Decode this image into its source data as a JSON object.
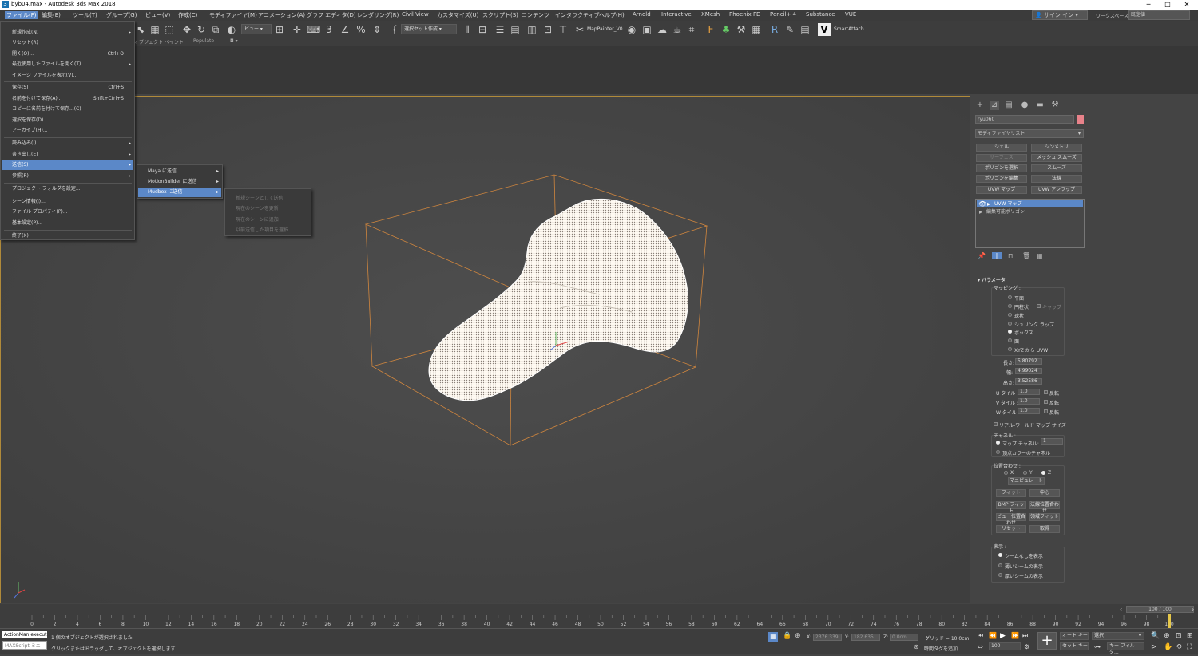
{
  "window": {
    "title": "byb04.max - Autodesk 3ds Max 2018",
    "minimize": "─",
    "maximize": "□",
    "close": "✕"
  },
  "menubar": {
    "items": [
      "ファイル(F)",
      "編集(E)",
      "ツール(T)",
      "グループ(G)",
      "ビュー(V)",
      "作成(C)",
      "モディファイヤ(M)",
      "アニメーション(A)",
      "グラフ エディタ(D)",
      "レンダリング(R)",
      "Civil View",
      "カスタマイズ(U)",
      "スクリプト(S)",
      "コンテンツ",
      "インタラクティブ",
      "ヘルプ(H)",
      "Arnold",
      "Interactive",
      "XMesh",
      "Phoenix FD",
      "Pencil+ 4",
      "Substance",
      "VUE"
    ],
    "signin": "サイン イン",
    "workspace_label": "ワークスペース:",
    "workspace_value": "既定値"
  },
  "toolbar": {
    "view_dropdown": "ビュー",
    "selection_set": "選択セット作成",
    "mappainter": "MapPainter_V0",
    "smartattach": "SmartAttach",
    "ribbon_label1": "オブジェクト ペイント",
    "ribbon_label2": "Populate"
  },
  "file_menu": {
    "items": [
      {
        "label": "新規作成(N)",
        "shortcut": "",
        "arrow": "▸"
      },
      {
        "label": "リセット(R)",
        "shortcut": "",
        "arrow": ""
      },
      {
        "label": "開く(O)...",
        "shortcut": "Ctrl+O",
        "arrow": ""
      },
      {
        "label": "最近使用したファイルを開く(T)",
        "shortcut": "",
        "arrow": "▸"
      },
      {
        "label": "イメージ ファイルを表示(V)...",
        "shortcut": "",
        "arrow": ""
      },
      {
        "label": "保存(S)",
        "shortcut": "Ctrl+S",
        "arrow": ""
      },
      {
        "label": "名前を付けて保存(A)...",
        "shortcut": "Shift+Ctrl+S",
        "arrow": ""
      },
      {
        "label": "コピーに名前を付けて保存...(C)",
        "shortcut": "",
        "arrow": ""
      },
      {
        "label": "選択を保存(D)...",
        "shortcut": "",
        "arrow": ""
      },
      {
        "label": "アーカイブ(H)...",
        "shortcut": "",
        "arrow": ""
      },
      {
        "label": "読み込み(I)",
        "shortcut": "",
        "arrow": "▸"
      },
      {
        "label": "書き出し(E)",
        "shortcut": "",
        "arrow": "▸"
      },
      {
        "label": "送信(S)",
        "shortcut": "",
        "arrow": "▸"
      },
      {
        "label": "参照(R)",
        "shortcut": "",
        "arrow": "▸"
      },
      {
        "label": "プロジェクト フォルダを設定...",
        "shortcut": "",
        "arrow": ""
      },
      {
        "label": "シーン情報(I)...",
        "shortcut": "",
        "arrow": ""
      },
      {
        "label": "ファイル プロパティ(P)...",
        "shortcut": "",
        "arrow": ""
      },
      {
        "label": "基本設定(P)...",
        "shortcut": "",
        "arrow": ""
      },
      {
        "label": "終了(X)",
        "shortcut": "",
        "arrow": ""
      }
    ]
  },
  "send_submenu": {
    "items": [
      {
        "label": "Maya に送信",
        "arrow": "▸"
      },
      {
        "label": "MotionBuilder に送信",
        "arrow": "▸"
      },
      {
        "label": "Mudbox に送信",
        "arrow": "▸"
      }
    ]
  },
  "mudbox_submenu": {
    "items": [
      "新規シーンとして送信",
      "現在のシーンを更新",
      "現在のシーンに追加",
      "以前送信した項目を選択"
    ]
  },
  "command_panel": {
    "object_name": "ryu060",
    "object_color": "#e8828a",
    "modifier_list": "モディファイヤリスト",
    "modifier_buttons": [
      {
        "label": "シェル",
        "dim": false
      },
      {
        "label": "シンメトリ",
        "dim": false
      },
      {
        "label": "サーフェス",
        "dim": true
      },
      {
        "label": "メッシュ スムーズ",
        "dim": false
      },
      {
        "label": "ポリゴンを選択",
        "dim": false
      },
      {
        "label": "スムーズ",
        "dim": false
      },
      {
        "label": "ポリゴンを編集",
        "dim": false
      },
      {
        "label": "法線",
        "dim": false
      },
      {
        "label": "UVW マップ",
        "dim": false
      },
      {
        "label": "UVW アンラップ",
        "dim": false
      }
    ],
    "stack": [
      "UVW マップ",
      "編集可能ポリゴン"
    ]
  },
  "parameters": {
    "title": "パラメータ",
    "mapping_label": "マッピング :",
    "mapping_options": [
      "平面",
      "円柱状",
      "球状",
      "シュリンク ラップ",
      "ボックス",
      "面",
      "XYZ から UVW"
    ],
    "cap_label": "キャップ",
    "length_label": "長さ:",
    "length_value": "5.80792",
    "width_label": "幅:",
    "width_value": "4.99024",
    "height_label": "高さ:",
    "height_value": "3.52586",
    "u_tile_label": "U タイル :",
    "u_tile": "1.0",
    "v_tile_label": "V タイル :",
    "v_tile": "1.0",
    "w_tile_label": "W タイル :",
    "w_tile": "1.0",
    "flip_label": "反転",
    "realworld": "リアル-ワールド マップ サイズ",
    "channel_label": "チャネル :",
    "map_channel_label": "マップ チャネル:",
    "map_channel": "1",
    "vertex_color_channel": "頂点カラーのチャネル",
    "alignment_label": "位置合わせ :",
    "axis_x": "X",
    "axis_y": "Y",
    "axis_z": "Z",
    "manipulate": "マニピュレート",
    "fit": "フィット",
    "center": "中心",
    "bitmap_fit": "BMP フィット",
    "normal_align": "法線位置合わせ",
    "view_align": "ビュー位置合わせ",
    "region_fit": "領域フィット",
    "reset": "リセット",
    "acquire": "取得",
    "display_label": "表示 :",
    "display_options": [
      "シームなしを表示",
      "薄いシームの表示",
      "厚いシームの表示"
    ]
  },
  "timeline": {
    "slider": "100 / 100",
    "ticks": [
      "0",
      "2",
      "4",
      "6",
      "8",
      "10",
      "12",
      "14",
      "16",
      "18",
      "20",
      "22",
      "24",
      "26",
      "28",
      "30",
      "32",
      "34",
      "36",
      "38",
      "40",
      "42",
      "44",
      "46",
      "48",
      "50",
      "52",
      "54",
      "56",
      "58",
      "60",
      "62",
      "64",
      "66",
      "68",
      "70",
      "72",
      "74",
      "76",
      "78",
      "80",
      "82",
      "84",
      "86",
      "88",
      "90",
      "92",
      "94",
      "96",
      "98",
      "100"
    ]
  },
  "status": {
    "maxscript_line1": "ActionMan.execut",
    "maxscript_line2": "MAXScript ミニ",
    "message1": "1 個のオブジェクトが選択されました",
    "message2": "クリックまたはドラッグして、オブジェクトを選択します",
    "x_label": "X:",
    "x_value": "2376.339",
    "y_label": "Y:",
    "y_value": "182.635",
    "z_label": "Z:",
    "z_value": "0.0cm",
    "grid": "グリッド = 10.0cm",
    "time_tag": "時間タグを追加",
    "frame": "100",
    "autokey": "オート キー",
    "setkey": "セット キー",
    "selection": "選択",
    "key_filter": "キー フィルタ..."
  }
}
